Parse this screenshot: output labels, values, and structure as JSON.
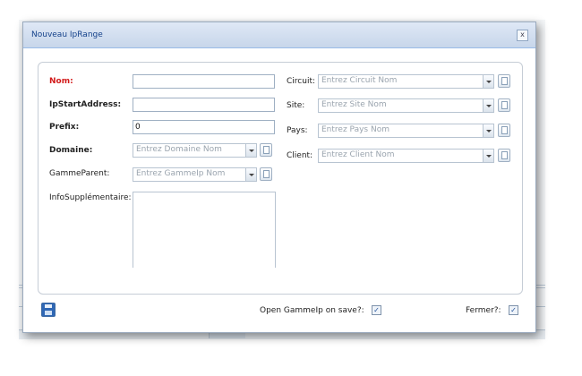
{
  "window": {
    "title": "Nouveau IpRange",
    "close_label": "x"
  },
  "form": {
    "nom": {
      "label": "Nom:",
      "value": ""
    },
    "ip_start": {
      "label": "IpStartAddress:",
      "value": ""
    },
    "prefix": {
      "label": "Prefix:",
      "value": "0"
    },
    "domaine": {
      "label": "Domaine:",
      "placeholder": "Entrez Domaine Nom"
    },
    "gamme_parent": {
      "label": "GammeParent:",
      "placeholder": "Entrez GammeIp Nom"
    },
    "info": {
      "label": "InfoSupplémentaire:",
      "value": ""
    },
    "circuit": {
      "label": "Circuit:",
      "placeholder": "Entrez Circuit Nom"
    },
    "site": {
      "label": "Site:",
      "placeholder": "Entrez Site Nom"
    },
    "pays": {
      "label": "Pays:",
      "placeholder": "Entrez Pays Nom"
    },
    "client": {
      "label": "Client:",
      "placeholder": "Entrez Client Nom"
    }
  },
  "footer": {
    "open_gamme_label": "Open GammeIp on save?:",
    "open_gamme_checked": true,
    "fermer_label": "Fermer?:",
    "fermer_checked": true,
    "checkmark": "✓"
  },
  "icons": {
    "save": "save-icon",
    "trigger": "chevron-down-icon",
    "picker": "picker-icon"
  }
}
